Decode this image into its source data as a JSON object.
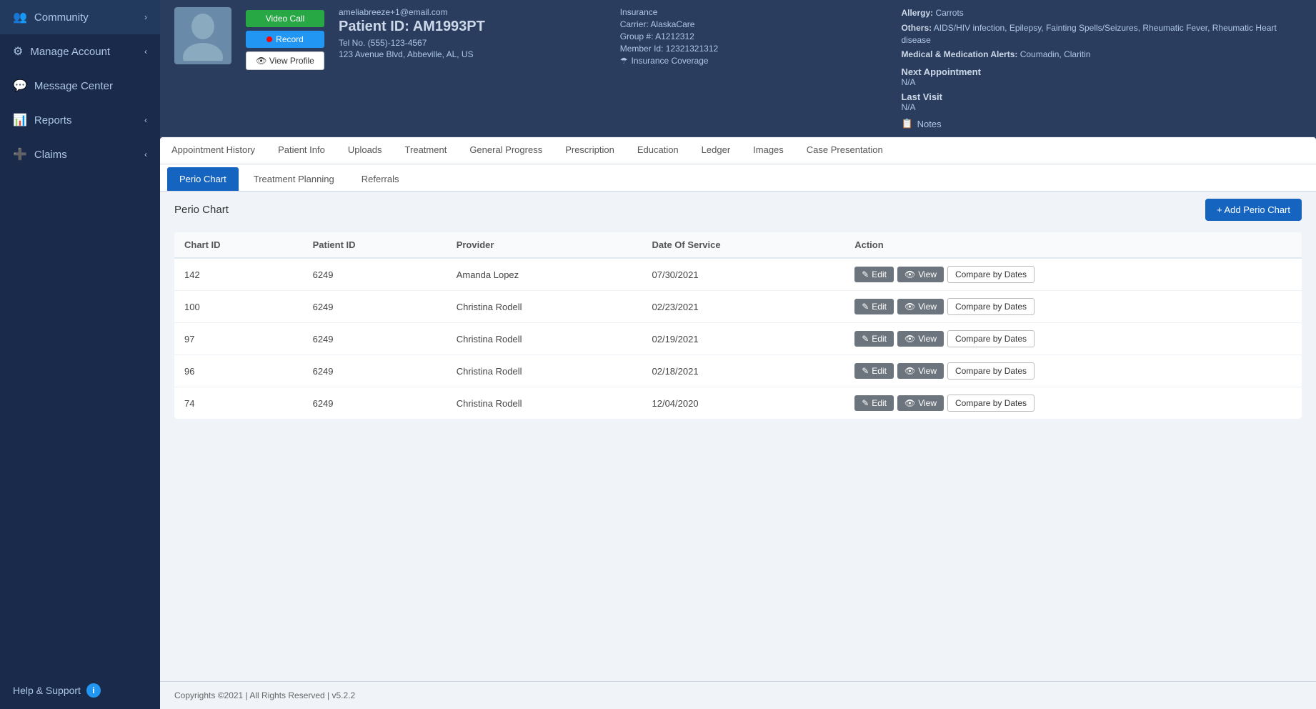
{
  "sidebar": {
    "items": [
      {
        "id": "community",
        "label": "Community",
        "icon": "👥",
        "hasChevron": true
      },
      {
        "id": "manage-account",
        "label": "Manage Account",
        "icon": "⚙",
        "hasChevron": true
      },
      {
        "id": "message-center",
        "label": "Message Center",
        "icon": "💬",
        "hasChevron": false
      },
      {
        "id": "reports",
        "label": "Reports",
        "icon": "📊",
        "hasChevron": true
      },
      {
        "id": "claims",
        "label": "Claims",
        "icon": "➕",
        "hasChevron": true
      }
    ],
    "help_label": "Help & Support"
  },
  "patient": {
    "email": "ameliabreeze+1@email.com",
    "id": "Patient ID: AM1993PT",
    "phone": "Tel No. (555)-123-4567",
    "address": "123 Avenue Blvd, Abbeville, AL, US",
    "photo_placeholder": "👤"
  },
  "buttons": {
    "video_call": "Video Call",
    "record": "Record",
    "view_profile": "👁 View Profile"
  },
  "insurance": {
    "label": "Insurance",
    "carrier_label": "Carrier:",
    "carrier": "AlaskaCare",
    "group_label": "Group #:",
    "group": "A1212312",
    "member_label": "Member Id:",
    "member": "12321321312",
    "coverage_label": "Insurance Coverage"
  },
  "medical": {
    "allergy_label": "Allergy:",
    "allergy": "Carrots",
    "others_label": "Others:",
    "others": "AIDS/HIV infection, Epilepsy, Fainting Spells/Seizures, Rheumatic Fever, Rheumatic Heart disease",
    "alerts_label": "Medical & Medication Alerts:",
    "alerts": "Coumadin, Claritin",
    "next_appt_label": "Next Appointment",
    "next_appt_value": "N/A",
    "last_visit_label": "Last Visit",
    "last_visit_value": "N/A",
    "notes_label": "Notes"
  },
  "tabs_row1": [
    {
      "id": "appointment-history",
      "label": "Appointment History",
      "active": false
    },
    {
      "id": "patient-info",
      "label": "Patient Info",
      "active": false
    },
    {
      "id": "uploads",
      "label": "Uploads",
      "active": false
    },
    {
      "id": "treatment",
      "label": "Treatment",
      "active": false
    },
    {
      "id": "general-progress",
      "label": "General Progress",
      "active": false
    },
    {
      "id": "prescription",
      "label": "Prescription",
      "active": false
    },
    {
      "id": "education",
      "label": "Education",
      "active": false
    },
    {
      "id": "ledger",
      "label": "Ledger",
      "active": false
    },
    {
      "id": "images",
      "label": "Images",
      "active": false
    },
    {
      "id": "case-presentation",
      "label": "Case Presentation",
      "active": false
    }
  ],
  "tabs_row2": [
    {
      "id": "perio-chart",
      "label": "Perio Chart",
      "active": true
    },
    {
      "id": "treatment-planning",
      "label": "Treatment Planning",
      "active": false
    },
    {
      "id": "referrals",
      "label": "Referrals",
      "active": false
    }
  ],
  "perio_section": {
    "title": "Perio Chart",
    "add_button": "+ Add Perio Chart"
  },
  "table": {
    "columns": [
      "Chart ID",
      "Patient ID",
      "Provider",
      "Date Of Service",
      "Action"
    ],
    "rows": [
      {
        "chart_id": "142",
        "patient_id": "6249",
        "provider": "Amanda Lopez",
        "date": "07/30/2021"
      },
      {
        "chart_id": "100",
        "patient_id": "6249",
        "provider": "Christina Rodell",
        "date": "02/23/2021"
      },
      {
        "chart_id": "97",
        "patient_id": "6249",
        "provider": "Christina Rodell",
        "date": "02/19/2021"
      },
      {
        "chart_id": "96",
        "patient_id": "6249",
        "provider": "Christina Rodell",
        "date": "02/18/2021"
      },
      {
        "chart_id": "74",
        "patient_id": "6249",
        "provider": "Christina Rodell",
        "date": "12/04/2020"
      }
    ],
    "action_edit": "Edit",
    "action_view": "View",
    "action_compare": "Compare by Dates"
  },
  "footer": {
    "text": "Copyrights ©2021 | All Rights Reserved | v5.2.2"
  }
}
